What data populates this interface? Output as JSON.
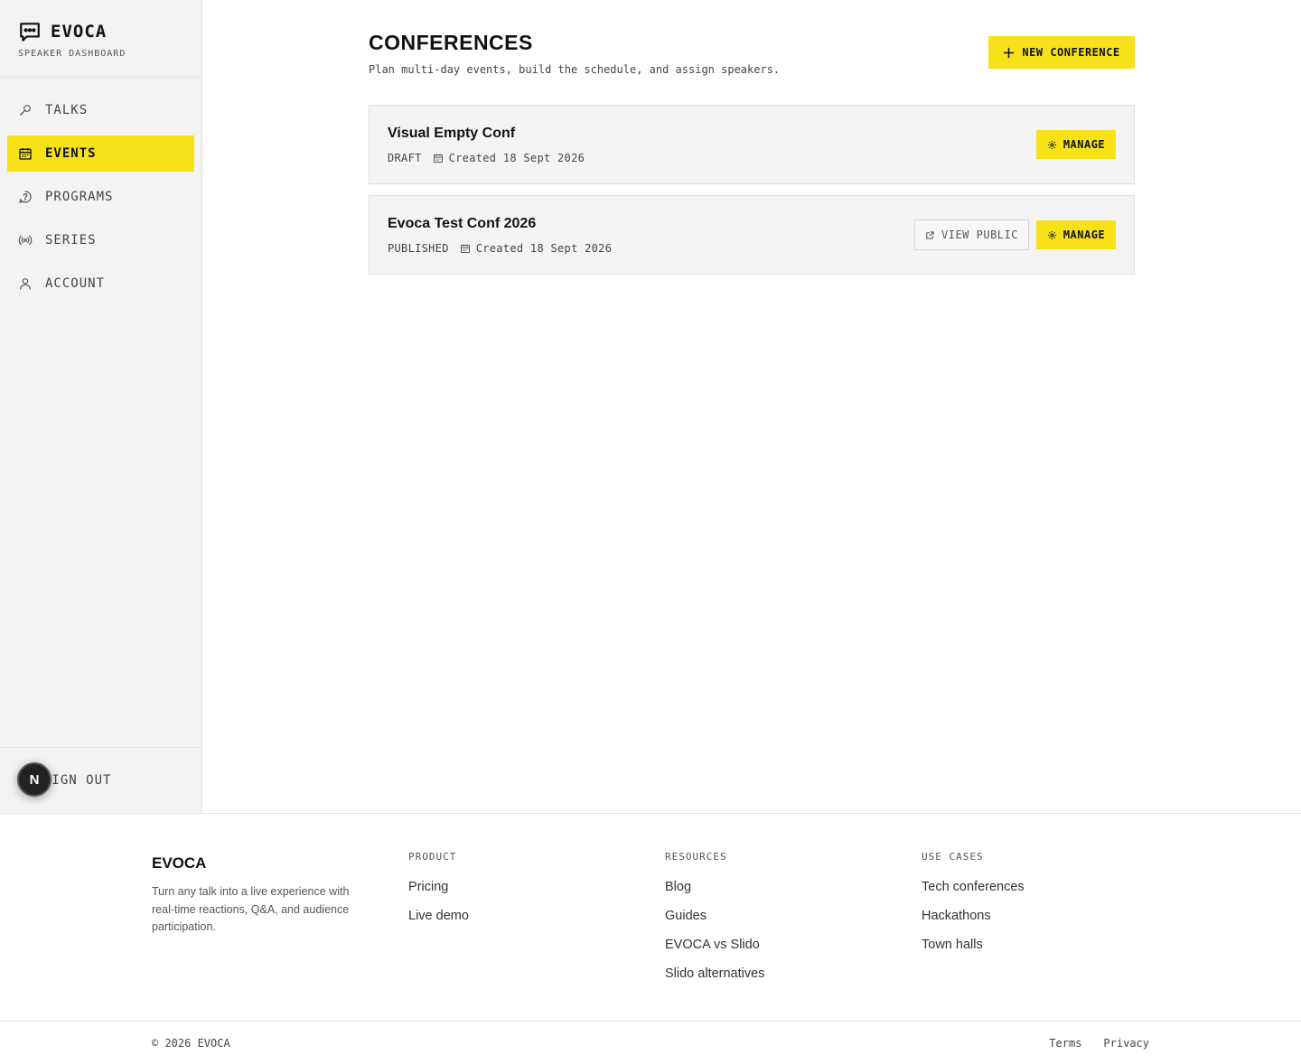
{
  "sidebar": {
    "brand": "EVOCA",
    "subtitle": "SPEAKER DASHBOARD",
    "items": [
      {
        "label": "TALKS",
        "icon": "mic-icon",
        "active": false
      },
      {
        "label": "EVENTS",
        "icon": "calendar-icon",
        "active": true
      },
      {
        "label": "PROGRAMS",
        "icon": "chat-question-icon",
        "active": false
      },
      {
        "label": "SERIES",
        "icon": "broadcast-icon",
        "active": false
      },
      {
        "label": "ACCOUNT",
        "icon": "user-icon",
        "active": false
      }
    ],
    "sign_out": "SIGN OUT",
    "dev_badge": "N"
  },
  "main": {
    "title": "CONFERENCES",
    "subtitle": "Plan multi-day events, build the schedule, and assign speakers.",
    "new_button": "NEW CONFERENCE",
    "conferences": [
      {
        "name": "Visual Empty Conf",
        "status": "DRAFT",
        "created": "Created 18 Sept 2026",
        "manage": "MANAGE"
      },
      {
        "name": "Evoca Test Conf 2026",
        "status": "PUBLISHED",
        "created": "Created 18 Sept 2026",
        "view_public": "VIEW PUBLIC",
        "manage": "MANAGE"
      }
    ]
  },
  "footer": {
    "brand": "EVOCA",
    "description": "Turn any talk into a live experience with real-time reactions, Q&A, and audience participation.",
    "columns": [
      {
        "heading": "PRODUCT",
        "links": [
          "Pricing",
          "Live demo"
        ]
      },
      {
        "heading": "RESOURCES",
        "links": [
          "Blog",
          "Guides",
          "EVOCA vs Slido",
          "Slido alternatives"
        ]
      },
      {
        "heading": "USE CASES",
        "links": [
          "Tech conferences",
          "Hackathons",
          "Town halls"
        ]
      }
    ],
    "copyright": "© 2026 EVOCA",
    "legal": [
      "Terms",
      "Privacy"
    ]
  },
  "colors": {
    "accent": "#f7e21a",
    "sidebar_bg": "#f3f3f3",
    "card_bg": "#f4f4f4"
  }
}
